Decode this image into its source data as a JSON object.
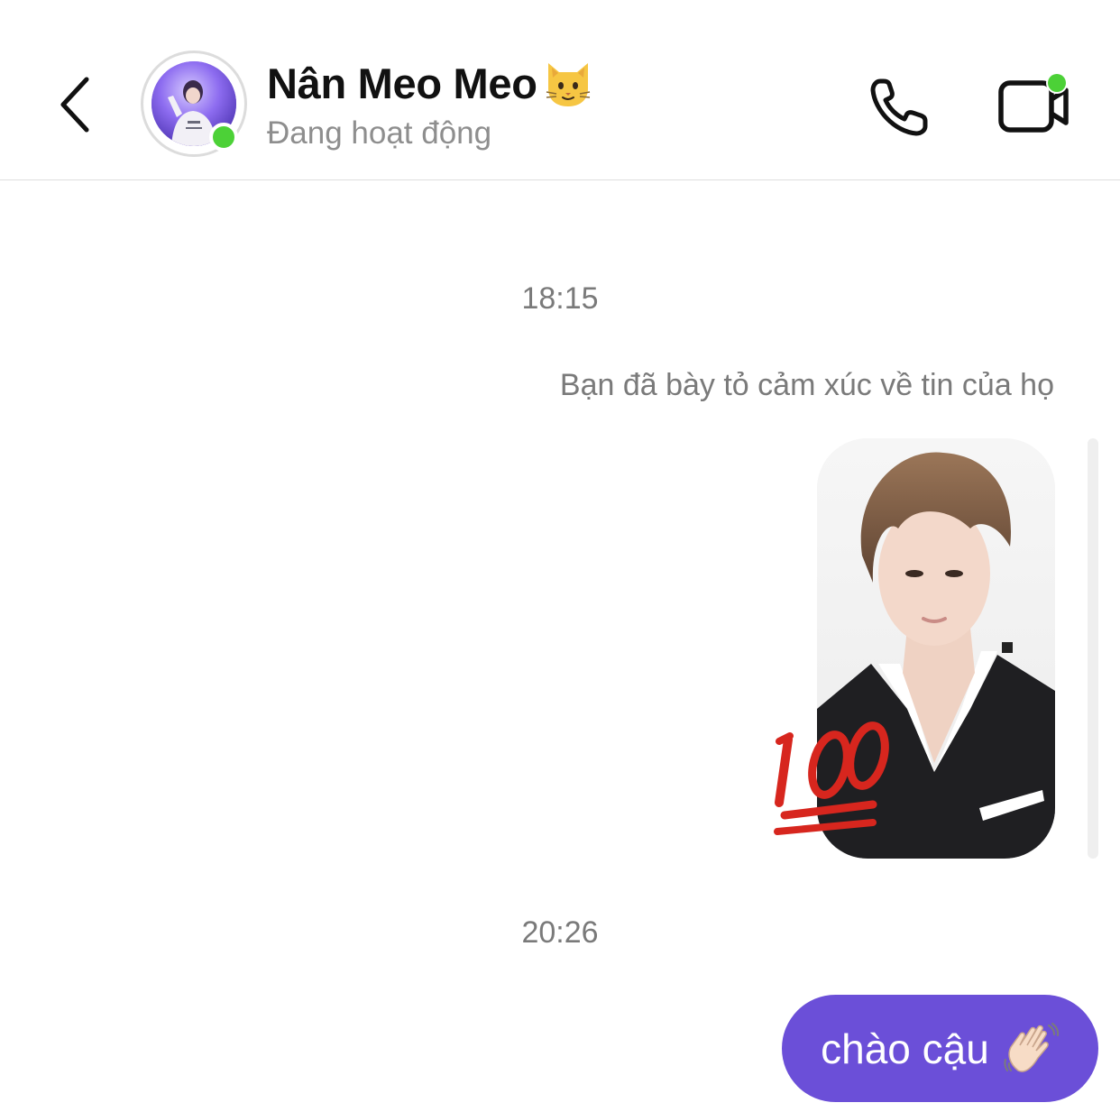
{
  "header": {
    "contact_name": "Nân Meo Meo",
    "name_emoji": "cat-face-emoji",
    "status": "Đang hoạt động",
    "online": true
  },
  "conversation": {
    "timestamp_1": "18:15",
    "reaction_note": "Bạn đã bày tỏ cảm xúc về tin của họ",
    "story_reaction": "hundred-points-emoji",
    "timestamp_2": "20:26",
    "sent_message": "chào cậu",
    "sent_message_emoji": "waving-hand-emoji"
  },
  "colors": {
    "accent": "#6b4fd8",
    "online": "#4cd137",
    "muted_text": "#7a7a7a",
    "reaction_red": "#d7261e"
  },
  "icons": {
    "back": "chevron-left-icon",
    "call": "phone-icon",
    "video": "video-camera-icon"
  }
}
